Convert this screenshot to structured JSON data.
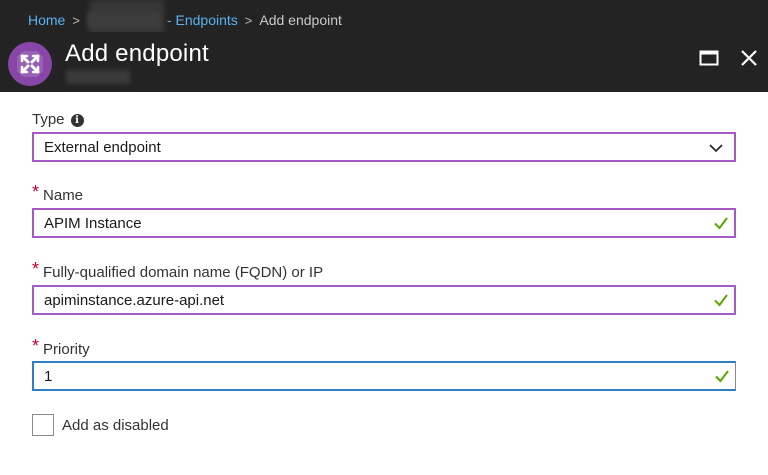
{
  "breadcrumb": {
    "home": "Home",
    "separator": ">",
    "endpoints": "- Endpoints",
    "current": "Add endpoint"
  },
  "header": {
    "title": "Add endpoint",
    "tile_icon": "traffic-manager-icon",
    "maximize_icon": "maximize-icon",
    "close_icon": "close-icon"
  },
  "form": {
    "type": {
      "label": "Type",
      "value": "External endpoint"
    },
    "name": {
      "required_mark": "*",
      "label": "Name",
      "value": "APIM Instance"
    },
    "fqdn": {
      "required_mark": "*",
      "label": "Fully-qualified domain name (FQDN) or IP",
      "value": "apiminstance.azure-api.net"
    },
    "priority": {
      "required_mark": "*",
      "label": "Priority",
      "value": "1"
    },
    "disabled": {
      "label": "Add as disabled",
      "checked": false
    }
  },
  "colors": {
    "header_bg": "#232323",
    "link": "#5ab2f0",
    "accent_border": "#a35bc8",
    "focus_border": "#2f7ec9",
    "valid_check": "#5aa700",
    "required": "#c3002f"
  }
}
